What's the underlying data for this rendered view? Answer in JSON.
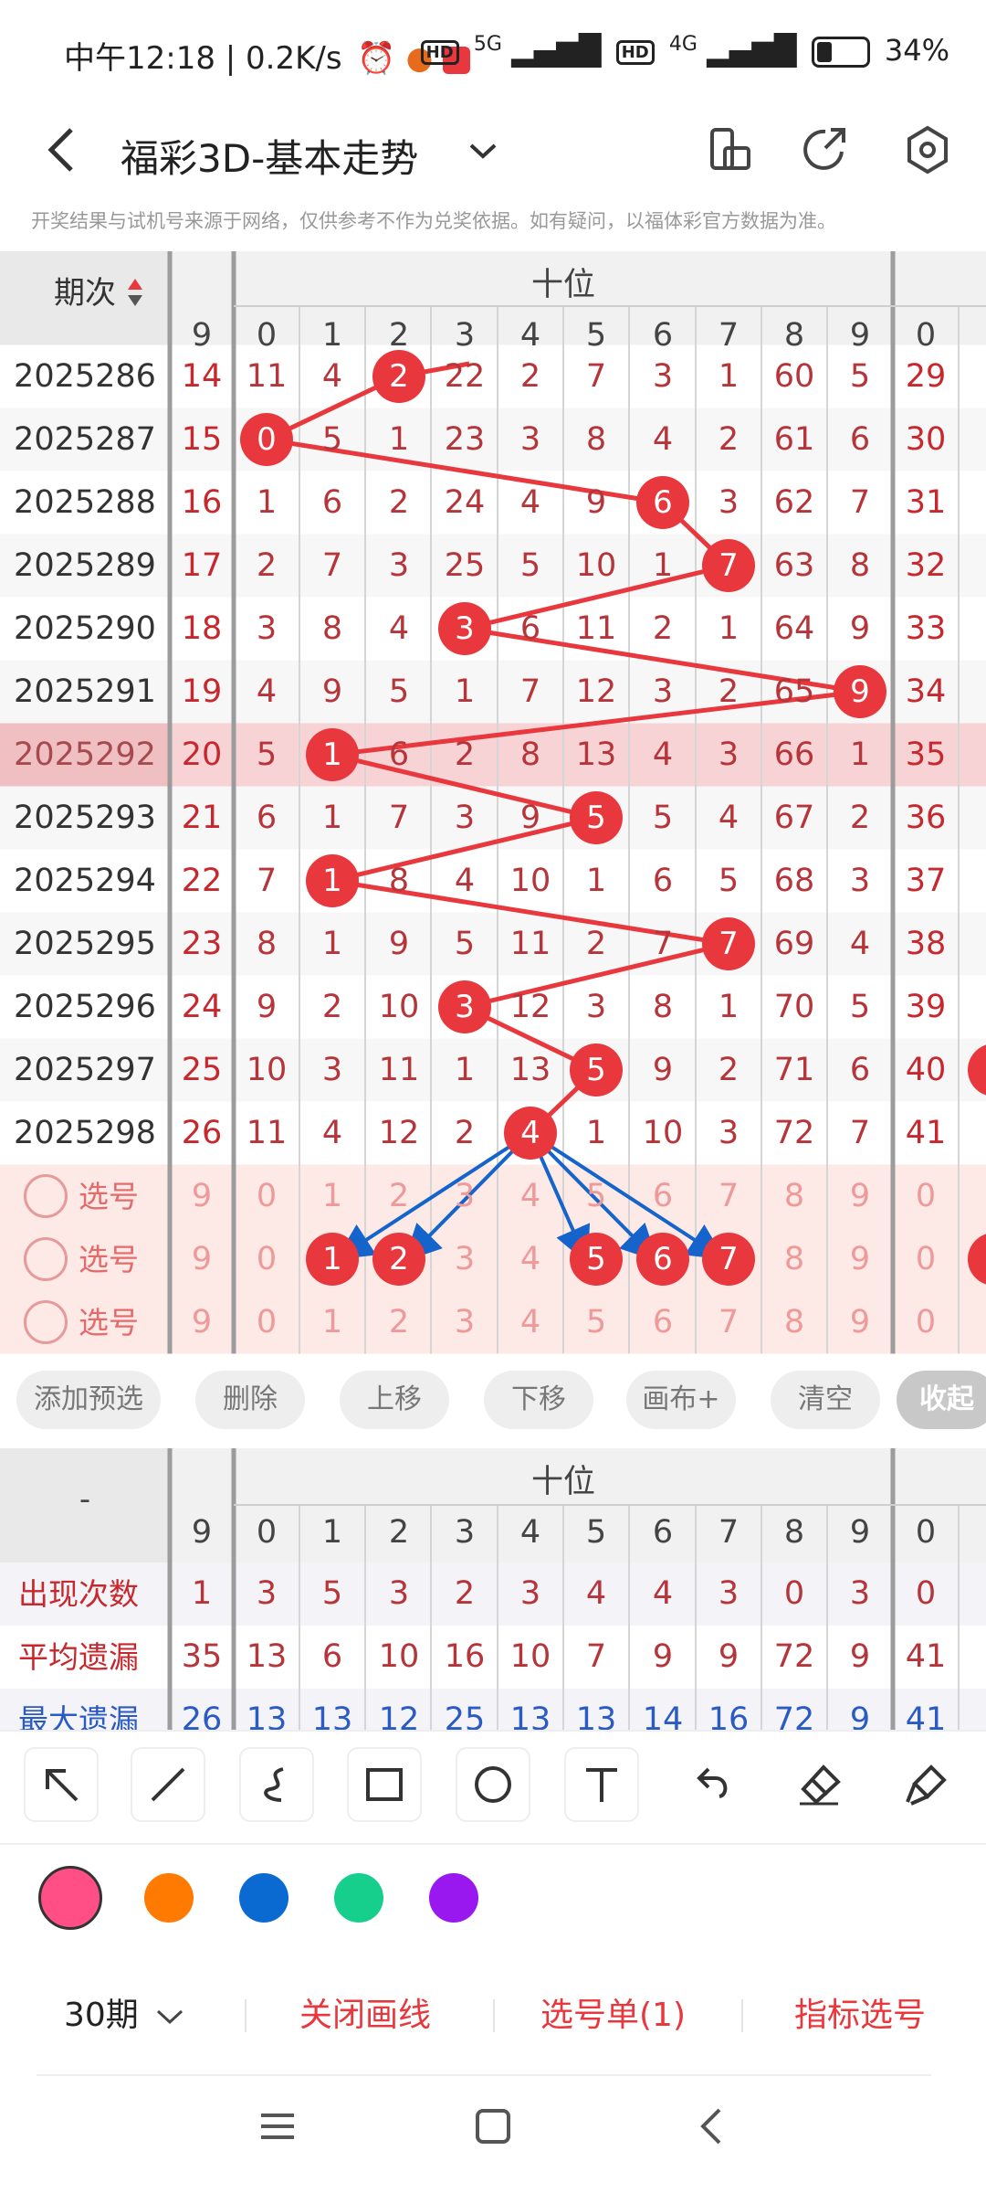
{
  "status_bar": {
    "time": "中午12:18 | 0.2K/s",
    "net_5g": "5G",
    "net_4g": "4G",
    "hd": "HD",
    "battery": "34%"
  },
  "header": {
    "title": "福彩3D-基本走势"
  },
  "notice": "开奖结果与试机号来源于网络，仅供参考不作为兑奖依据。如有疑问，以福体彩官方数据为准。",
  "table": {
    "period_header": "期次",
    "group_label": "十位",
    "col_headers": [
      "9",
      "0",
      "1",
      "2",
      "3",
      "4",
      "5",
      "6",
      "7",
      "8",
      "9",
      "0"
    ],
    "rows": [
      {
        "period": "2025286",
        "cells": [
          "14",
          "11",
          "4",
          "2",
          "22",
          "2",
          "7",
          "3",
          "1",
          "60",
          "5",
          "29"
        ]
      },
      {
        "period": "2025287",
        "cells": [
          "15",
          "0",
          "5",
          "1",
          "23",
          "3",
          "8",
          "4",
          "2",
          "61",
          "6",
          "30"
        ]
      },
      {
        "period": "2025288",
        "cells": [
          "16",
          "1",
          "6",
          "2",
          "24",
          "4",
          "9",
          "6",
          "3",
          "62",
          "7",
          "31"
        ]
      },
      {
        "period": "2025289",
        "cells": [
          "17",
          "2",
          "7",
          "3",
          "25",
          "5",
          "10",
          "1",
          "7",
          "63",
          "8",
          "32"
        ]
      },
      {
        "period": "2025290",
        "cells": [
          "18",
          "3",
          "8",
          "4",
          "3",
          "6",
          "11",
          "2",
          "1",
          "64",
          "9",
          "33"
        ]
      },
      {
        "period": "2025291",
        "cells": [
          "19",
          "4",
          "9",
          "5",
          "1",
          "7",
          "12",
          "3",
          "2",
          "65",
          "9",
          "34"
        ]
      },
      {
        "period": "2025292",
        "cells": [
          "20",
          "5",
          "1",
          "6",
          "2",
          "8",
          "13",
          "4",
          "3",
          "66",
          "1",
          "35"
        ]
      },
      {
        "period": "2025293",
        "cells": [
          "21",
          "6",
          "1",
          "7",
          "3",
          "9",
          "5",
          "5",
          "4",
          "67",
          "2",
          "36"
        ]
      },
      {
        "period": "2025294",
        "cells": [
          "22",
          "7",
          "1",
          "8",
          "4",
          "10",
          "1",
          "6",
          "5",
          "68",
          "3",
          "37"
        ]
      },
      {
        "period": "2025295",
        "cells": [
          "23",
          "8",
          "1",
          "9",
          "5",
          "11",
          "2",
          "7",
          "7",
          "69",
          "4",
          "38"
        ]
      },
      {
        "period": "2025296",
        "cells": [
          "24",
          "9",
          "2",
          "10",
          "3",
          "12",
          "3",
          "8",
          "1",
          "70",
          "5",
          "39"
        ]
      },
      {
        "period": "2025297",
        "cells": [
          "25",
          "10",
          "3",
          "11",
          "1",
          "13",
          "5",
          "9",
          "2",
          "71",
          "6",
          "40"
        ]
      },
      {
        "period": "2025298",
        "cells": [
          "26",
          "11",
          "4",
          "12",
          "2",
          "4",
          "1",
          "10",
          "3",
          "72",
          "7",
          "41"
        ]
      }
    ],
    "select_label": "选号",
    "select_row_cells": [
      "9",
      "0",
      "1",
      "2",
      "3",
      "4",
      "5",
      "6",
      "7",
      "8",
      "9",
      "0"
    ]
  },
  "actions": {
    "add_preselect": "添加预选",
    "delete": "删除",
    "move_up": "上移",
    "move_down": "下移",
    "canvas_plus": "画布+",
    "clear": "清空",
    "collapse": "收起"
  },
  "stats": {
    "dash": "-",
    "group_label": "十位",
    "col_headers": [
      "9",
      "0",
      "1",
      "2",
      "3",
      "4",
      "5",
      "6",
      "7",
      "8",
      "9",
      "0"
    ],
    "rows": [
      {
        "label": "出现次数",
        "cells": [
          "1",
          "3",
          "5",
          "3",
          "2",
          "3",
          "4",
          "4",
          "3",
          "0",
          "3",
          "0"
        ]
      },
      {
        "label": "平均遗漏",
        "cells": [
          "35",
          "13",
          "6",
          "10",
          "16",
          "10",
          "7",
          "9",
          "9",
          "72",
          "9",
          "41"
        ]
      },
      {
        "label": "最大遗漏",
        "cells": [
          "26",
          "13",
          "13",
          "12",
          "25",
          "13",
          "13",
          "14",
          "16",
          "72",
          "9",
          "41"
        ]
      }
    ]
  },
  "draw_colors": [
    "#ff4f86",
    "#ff7a00",
    "#0a6ad1",
    "#17cf8c",
    "#9a18f0"
  ],
  "footer": {
    "periods": "30期",
    "close_lines": "关闭画线",
    "selection_list": "选号单(1)",
    "indicator_select": "指标选号"
  }
}
